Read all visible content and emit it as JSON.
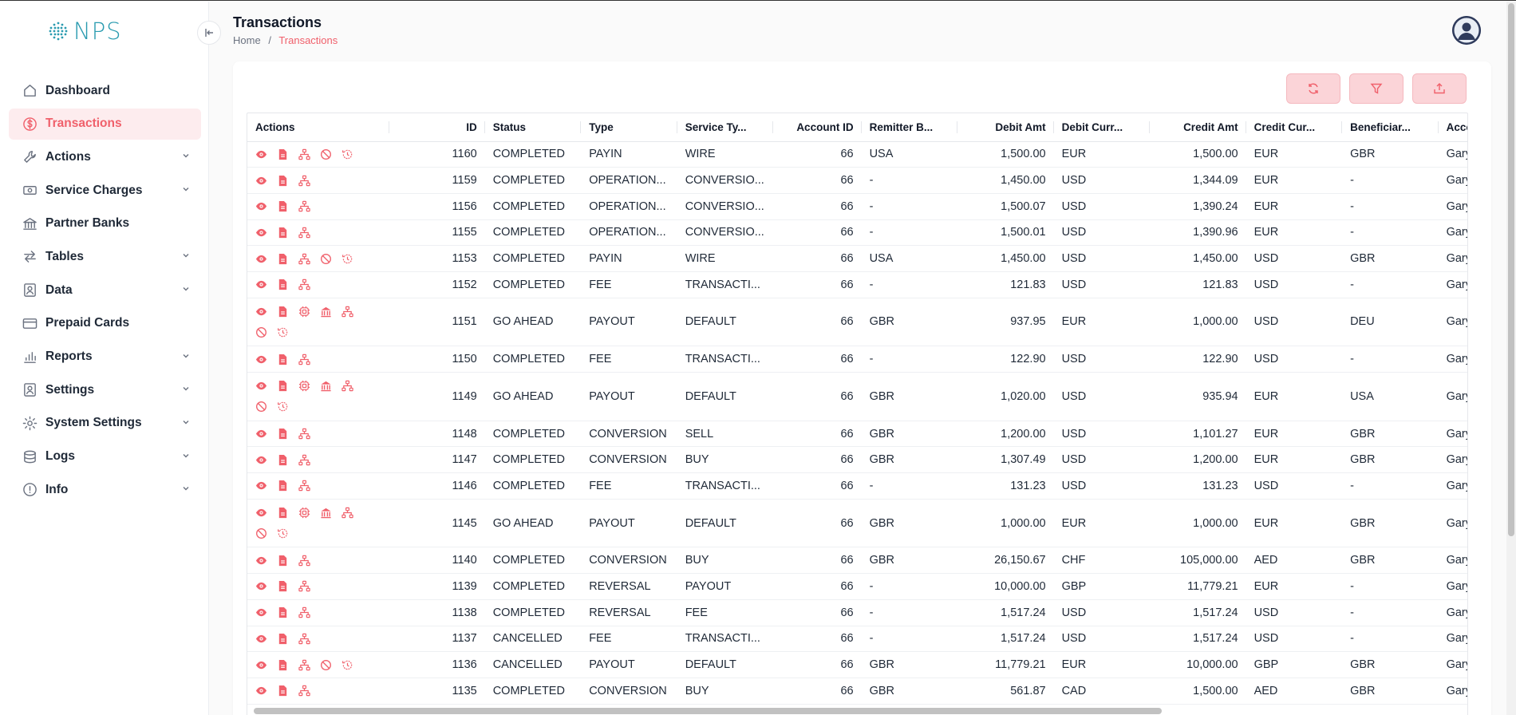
{
  "brand": {
    "name": "NPS",
    "accent": "#f0606b",
    "logo_color": "#2a9bb0"
  },
  "sidebar": {
    "items": [
      {
        "label": "Dashboard",
        "icon": "home-icon",
        "chevron": false
      },
      {
        "label": "Transactions",
        "icon": "dollar-circle-icon",
        "chevron": false,
        "active": true
      },
      {
        "label": "Actions",
        "icon": "wrench-icon",
        "chevron": true
      },
      {
        "label": "Service Charges",
        "icon": "banknote-icon",
        "chevron": true
      },
      {
        "label": "Partner Banks",
        "icon": "bank-icon",
        "chevron": false
      },
      {
        "label": "Tables",
        "icon": "arrows-icon",
        "chevron": true
      },
      {
        "label": "Data",
        "icon": "contact-card-icon",
        "chevron": true
      },
      {
        "label": "Prepaid Cards",
        "icon": "credit-card-icon",
        "chevron": false
      },
      {
        "label": "Reports",
        "icon": "bar-chart-icon",
        "chevron": true
      },
      {
        "label": "Settings",
        "icon": "user-settings-icon",
        "chevron": true
      },
      {
        "label": "System Settings",
        "icon": "gear-icon",
        "chevron": true
      },
      {
        "label": "Logs",
        "icon": "database-icon",
        "chevron": true
      },
      {
        "label": "Info",
        "icon": "info-icon",
        "chevron": true
      }
    ]
  },
  "header": {
    "title": "Transactions",
    "breadcrumb": {
      "home": "Home",
      "separator": "/",
      "current": "Transactions"
    }
  },
  "toolbar": {
    "buttons": [
      "refresh-icon",
      "filter-icon",
      "export-icon"
    ]
  },
  "table": {
    "columns": [
      "Actions",
      "ID",
      "Status",
      "Type",
      "Service Ty...",
      "Account ID",
      "Remitter B...",
      "Debit Amt",
      "Debit Curr...",
      "Credit Amt",
      "Credit Cur...",
      "Beneficiar...",
      "Accou"
    ],
    "rows": [
      {
        "actions": [
          "view",
          "doc",
          "flow",
          "cancel",
          "history"
        ],
        "id": "1160",
        "status": "COMPLETED",
        "type": "PAYIN",
        "service": "WIRE",
        "account": "66",
        "remitter": "USA",
        "debit_amt": "1,500.00",
        "debit_cur": "EUR",
        "credit_amt": "1,500.00",
        "credit_cur": "EUR",
        "beneficiary": "GBR",
        "acct_name": "Gary M"
      },
      {
        "actions": [
          "view",
          "doc",
          "flow"
        ],
        "id": "1159",
        "status": "COMPLETED",
        "type": "OPERATION...",
        "service": "CONVERSIO...",
        "account": "66",
        "remitter": "-",
        "debit_amt": "1,450.00",
        "debit_cur": "USD",
        "credit_amt": "1,344.09",
        "credit_cur": "EUR",
        "beneficiary": "-",
        "acct_name": "Gary M"
      },
      {
        "actions": [
          "view",
          "doc",
          "flow"
        ],
        "id": "1156",
        "status": "COMPLETED",
        "type": "OPERATION...",
        "service": "CONVERSIO...",
        "account": "66",
        "remitter": "-",
        "debit_amt": "1,500.07",
        "debit_cur": "USD",
        "credit_amt": "1,390.24",
        "credit_cur": "EUR",
        "beneficiary": "-",
        "acct_name": "Gary M"
      },
      {
        "actions": [
          "view",
          "doc",
          "flow"
        ],
        "id": "1155",
        "status": "COMPLETED",
        "type": "OPERATION...",
        "service": "CONVERSIO...",
        "account": "66",
        "remitter": "-",
        "debit_amt": "1,500.01",
        "debit_cur": "USD",
        "credit_amt": "1,390.96",
        "credit_cur": "EUR",
        "beneficiary": "-",
        "acct_name": "Gary M"
      },
      {
        "actions": [
          "view",
          "doc",
          "flow",
          "cancel",
          "history"
        ],
        "id": "1153",
        "status": "COMPLETED",
        "type": "PAYIN",
        "service": "WIRE",
        "account": "66",
        "remitter": "USA",
        "debit_amt": "1,450.00",
        "debit_cur": "USD",
        "credit_amt": "1,450.00",
        "credit_cur": "USD",
        "beneficiary": "GBR",
        "acct_name": "Gary M"
      },
      {
        "actions": [
          "view",
          "doc",
          "flow"
        ],
        "id": "1152",
        "status": "COMPLETED",
        "type": "FEE",
        "service": "TRANSACTI...",
        "account": "66",
        "remitter": "-",
        "debit_amt": "121.83",
        "debit_cur": "USD",
        "credit_amt": "121.83",
        "credit_cur": "USD",
        "beneficiary": "-",
        "acct_name": "Gary M"
      },
      {
        "actions": [
          "view",
          "doc",
          "chip",
          "bank",
          "flow",
          "cancel",
          "history"
        ],
        "id": "1151",
        "status": "GO AHEAD",
        "type": "PAYOUT",
        "service": "DEFAULT",
        "account": "66",
        "remitter": "GBR",
        "debit_amt": "937.95",
        "debit_cur": "EUR",
        "credit_amt": "1,000.00",
        "credit_cur": "USD",
        "beneficiary": "DEU",
        "acct_name": "Gary M"
      },
      {
        "actions": [
          "view",
          "doc",
          "flow"
        ],
        "id": "1150",
        "status": "COMPLETED",
        "type": "FEE",
        "service": "TRANSACTI...",
        "account": "66",
        "remitter": "-",
        "debit_amt": "122.90",
        "debit_cur": "USD",
        "credit_amt": "122.90",
        "credit_cur": "USD",
        "beneficiary": "-",
        "acct_name": "Gary M"
      },
      {
        "actions": [
          "view",
          "doc",
          "chip",
          "bank",
          "flow",
          "cancel",
          "history"
        ],
        "id": "1149",
        "status": "GO AHEAD",
        "type": "PAYOUT",
        "service": "DEFAULT",
        "account": "66",
        "remitter": "GBR",
        "debit_amt": "1,020.00",
        "debit_cur": "USD",
        "credit_amt": "935.94",
        "credit_cur": "EUR",
        "beneficiary": "USA",
        "acct_name": "Gary M"
      },
      {
        "actions": [
          "view",
          "doc",
          "flow"
        ],
        "id": "1148",
        "status": "COMPLETED",
        "type": "CONVERSION",
        "service": "SELL",
        "account": "66",
        "remitter": "GBR",
        "debit_amt": "1,200.00",
        "debit_cur": "USD",
        "credit_amt": "1,101.27",
        "credit_cur": "EUR",
        "beneficiary": "GBR",
        "acct_name": "Gary M"
      },
      {
        "actions": [
          "view",
          "doc",
          "flow"
        ],
        "id": "1147",
        "status": "COMPLETED",
        "type": "CONVERSION",
        "service": "BUY",
        "account": "66",
        "remitter": "GBR",
        "debit_amt": "1,307.49",
        "debit_cur": "USD",
        "credit_amt": "1,200.00",
        "credit_cur": "EUR",
        "beneficiary": "GBR",
        "acct_name": "Gary M"
      },
      {
        "actions": [
          "view",
          "doc",
          "flow"
        ],
        "id": "1146",
        "status": "COMPLETED",
        "type": "FEE",
        "service": "TRANSACTI...",
        "account": "66",
        "remitter": "-",
        "debit_amt": "131.23",
        "debit_cur": "USD",
        "credit_amt": "131.23",
        "credit_cur": "USD",
        "beneficiary": "-",
        "acct_name": "Gary M"
      },
      {
        "actions": [
          "view",
          "doc",
          "chip",
          "bank",
          "flow",
          "cancel",
          "history"
        ],
        "id": "1145",
        "status": "GO AHEAD",
        "type": "PAYOUT",
        "service": "DEFAULT",
        "account": "66",
        "remitter": "GBR",
        "debit_amt": "1,000.00",
        "debit_cur": "EUR",
        "credit_amt": "1,000.00",
        "credit_cur": "EUR",
        "beneficiary": "GBR",
        "acct_name": "Gary M"
      },
      {
        "actions": [
          "view",
          "doc",
          "flow"
        ],
        "id": "1140",
        "status": "COMPLETED",
        "type": "CONVERSION",
        "service": "BUY",
        "account": "66",
        "remitter": "GBR",
        "debit_amt": "26,150.67",
        "debit_cur": "CHF",
        "credit_amt": "105,000.00",
        "credit_cur": "AED",
        "beneficiary": "GBR",
        "acct_name": "Gary M"
      },
      {
        "actions": [
          "view",
          "doc",
          "flow"
        ],
        "id": "1139",
        "status": "COMPLETED",
        "type": "REVERSAL",
        "service": "PAYOUT",
        "account": "66",
        "remitter": "-",
        "debit_amt": "10,000.00",
        "debit_cur": "GBP",
        "credit_amt": "11,779.21",
        "credit_cur": "EUR",
        "beneficiary": "-",
        "acct_name": "Gary M"
      },
      {
        "actions": [
          "view",
          "doc",
          "flow"
        ],
        "id": "1138",
        "status": "COMPLETED",
        "type": "REVERSAL",
        "service": "FEE",
        "account": "66",
        "remitter": "-",
        "debit_amt": "1,517.24",
        "debit_cur": "USD",
        "credit_amt": "1,517.24",
        "credit_cur": "USD",
        "beneficiary": "-",
        "acct_name": "Gary M"
      },
      {
        "actions": [
          "view",
          "doc",
          "flow"
        ],
        "id": "1137",
        "status": "CANCELLED",
        "type": "FEE",
        "service": "TRANSACTI...",
        "account": "66",
        "remitter": "-",
        "debit_amt": "1,517.24",
        "debit_cur": "USD",
        "credit_amt": "1,517.24",
        "credit_cur": "USD",
        "beneficiary": "-",
        "acct_name": "Gary M"
      },
      {
        "actions": [
          "view",
          "doc",
          "flow",
          "cancel",
          "history"
        ],
        "id": "1136",
        "status": "CANCELLED",
        "type": "PAYOUT",
        "service": "DEFAULT",
        "account": "66",
        "remitter": "GBR",
        "debit_amt": "11,779.21",
        "debit_cur": "EUR",
        "credit_amt": "10,000.00",
        "credit_cur": "GBP",
        "beneficiary": "GBR",
        "acct_name": "Gary M"
      },
      {
        "actions": [
          "view",
          "doc",
          "flow"
        ],
        "id": "1135",
        "status": "COMPLETED",
        "type": "CONVERSION",
        "service": "BUY",
        "account": "66",
        "remitter": "GBR",
        "debit_amt": "561.87",
        "debit_cur": "CAD",
        "credit_amt": "1,500.00",
        "credit_cur": "AED",
        "beneficiary": "GBR",
        "acct_name": "Gary M"
      }
    ]
  }
}
